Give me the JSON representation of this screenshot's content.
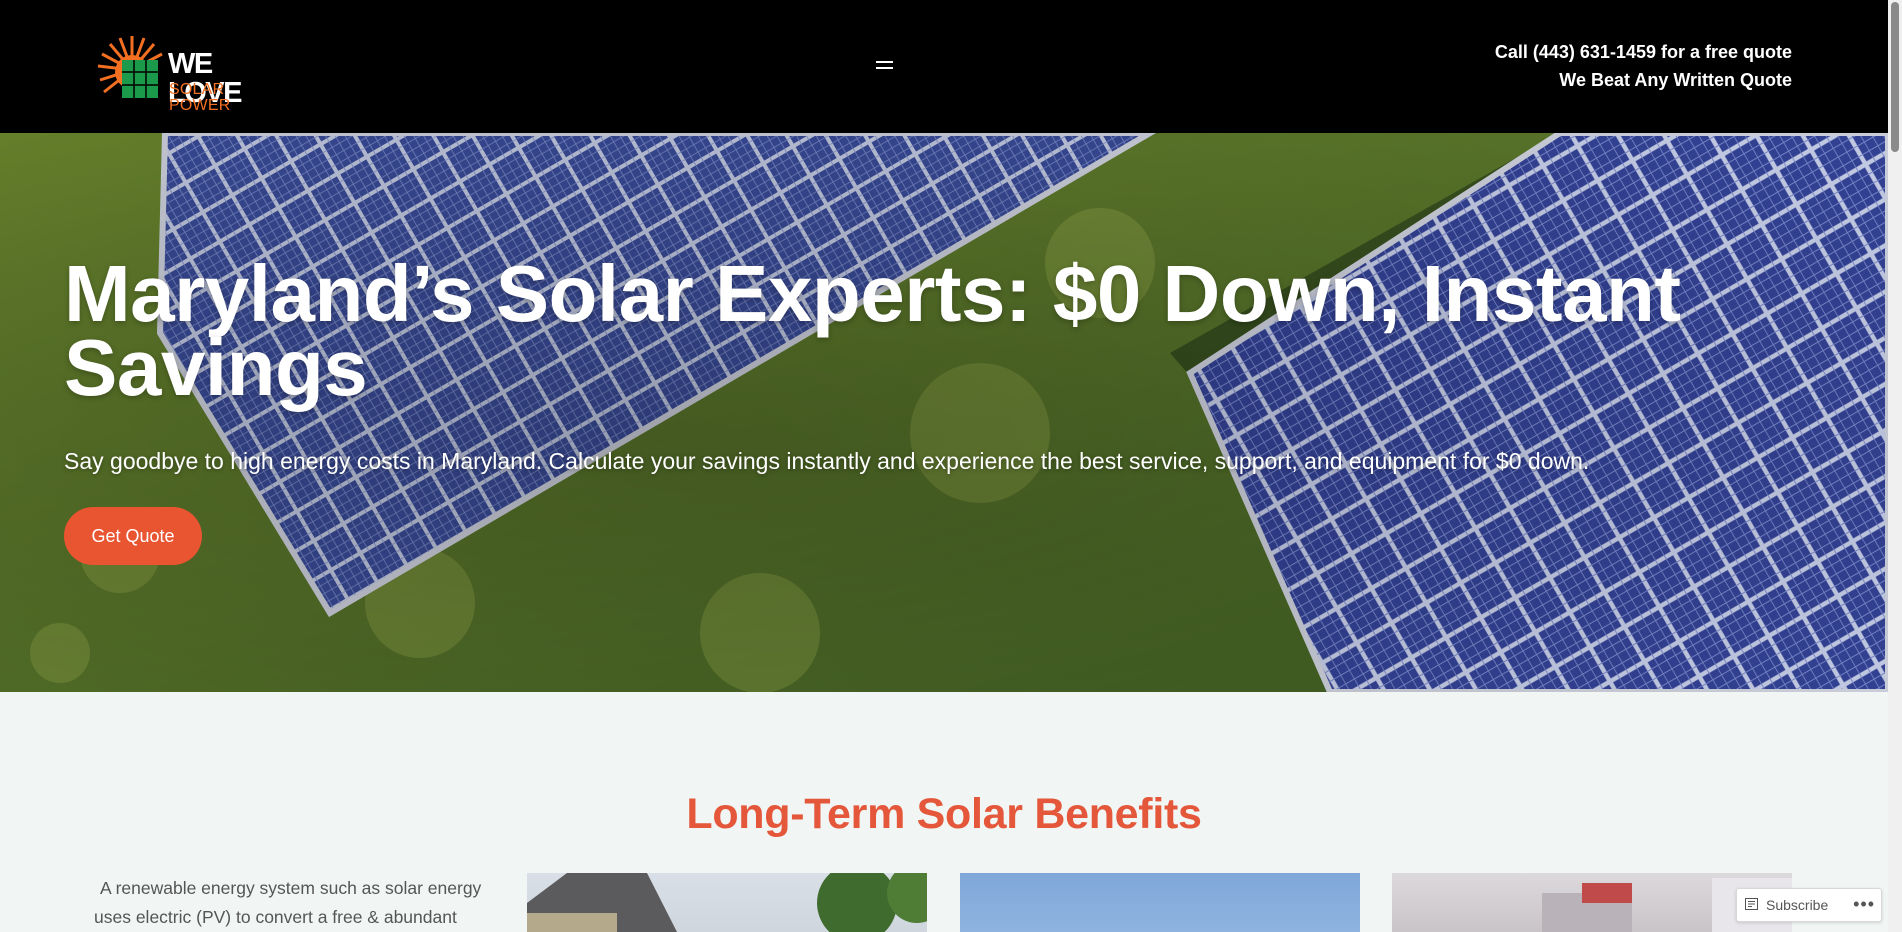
{
  "header": {
    "logo_top": "WE LOVE",
    "logo_bottom": "SOLAR POWER",
    "menu_icon": "hamburger-menu-icon",
    "phone_line": "Call (443) 631-1459 for a free quote",
    "promise_line": "We Beat Any Written Quote"
  },
  "hero": {
    "title": "Maryland’s Solar Experts: $0 Down, Instant Savings",
    "subtitle": "Say goodbye to high energy costs in Maryland. Calculate your savings instantly and experience the best service, support, and equipment for $0 down.",
    "cta_label": "Get Quote"
  },
  "benefits": {
    "title": "Long-Term Solar Benefits",
    "text": "A renewable energy system such as solar energy uses electric (PV) to convert a free & abundant"
  },
  "subscribe": {
    "label": "Subscribe",
    "more": "•••"
  },
  "colors": {
    "accent": "#e95431",
    "title_orange": "#e4573a",
    "header_bg": "#000000",
    "section_bg": "#f1f6f5"
  }
}
